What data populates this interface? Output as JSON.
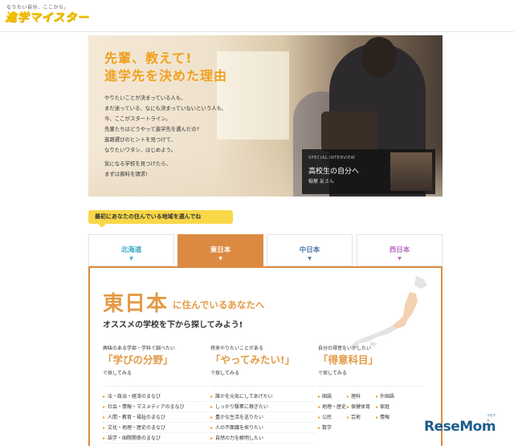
{
  "header": {
    "tagline": "なりたい自分、ここから。",
    "logo": "進学マイスター"
  },
  "hero": {
    "title_line1": "先輩、教えて!",
    "title_line2": "進学先を決めた理由",
    "body": [
      "やりたいことが決まっている人も、",
      "まだ迷っている、なにも決まっていないという人も、",
      "今、ここがスタートライン。",
      "先輩たちはどうやって進学先を選んだの?",
      "進路選びのヒントを見つけて、",
      "なりたいワタシ、はじめよう。"
    ],
    "note": [
      "気になる学校を見つけたら、",
      "まずは資料を請求!"
    ],
    "interview": {
      "label": "SPECIAL INTERVIEW",
      "title": "高校生の自分へ",
      "name": "稲葉 友さん"
    }
  },
  "prompt": "最初にあなたの住んでいる地域を選んでね",
  "tabs": [
    {
      "label": "北海道",
      "color": "#3aa8c2",
      "active": false
    },
    {
      "label": "東日本",
      "color": "#ffffff",
      "active": true
    },
    {
      "label": "中日本",
      "color": "#4a78a8",
      "active": false
    },
    {
      "label": "西日本",
      "color": "#b56cc0",
      "active": false
    }
  ],
  "tab_arrow": "▼",
  "content": {
    "region": "東日本",
    "region_suffix": "に住んでいるあなたへ",
    "subtitle": "オススメの学校を下から探してみよう!",
    "columns": [
      {
        "intro": "興味のある学部・学科で調べたい",
        "quote": "「学びの分野」",
        "search": "で探してみる",
        "items": [
          "法・政治・経済のまなび",
          "社会・情報・マスメディアのまなび",
          "人間・教育・福祉のまなび",
          "文化・地理・歴史のまなび",
          "語学・国際関係のまなび"
        ]
      },
      {
        "intro": "将来やりたいことがある",
        "quote": "「やってみたい!」",
        "search": "で探してみる",
        "items": [
          "誰かを元気にしてあげたい",
          "しっかり駆素に稼ぎたい",
          "豊かな生活を送りたい",
          "人の不面議を探りたい",
          "自然の力を解明したい"
        ]
      },
      {
        "intro": "自分の得意をいかしたい",
        "quote": "「得意科目」",
        "search": "で探してみる",
        "subjects": [
          "国語",
          "理科",
          "外国語",
          "地理・歴史",
          "保健体育",
          "家庭",
          "公民",
          "芸術",
          "情報",
          "数学"
        ]
      }
    ]
  },
  "watermark": "ReseMom",
  "watermark_sub": "リセマム"
}
